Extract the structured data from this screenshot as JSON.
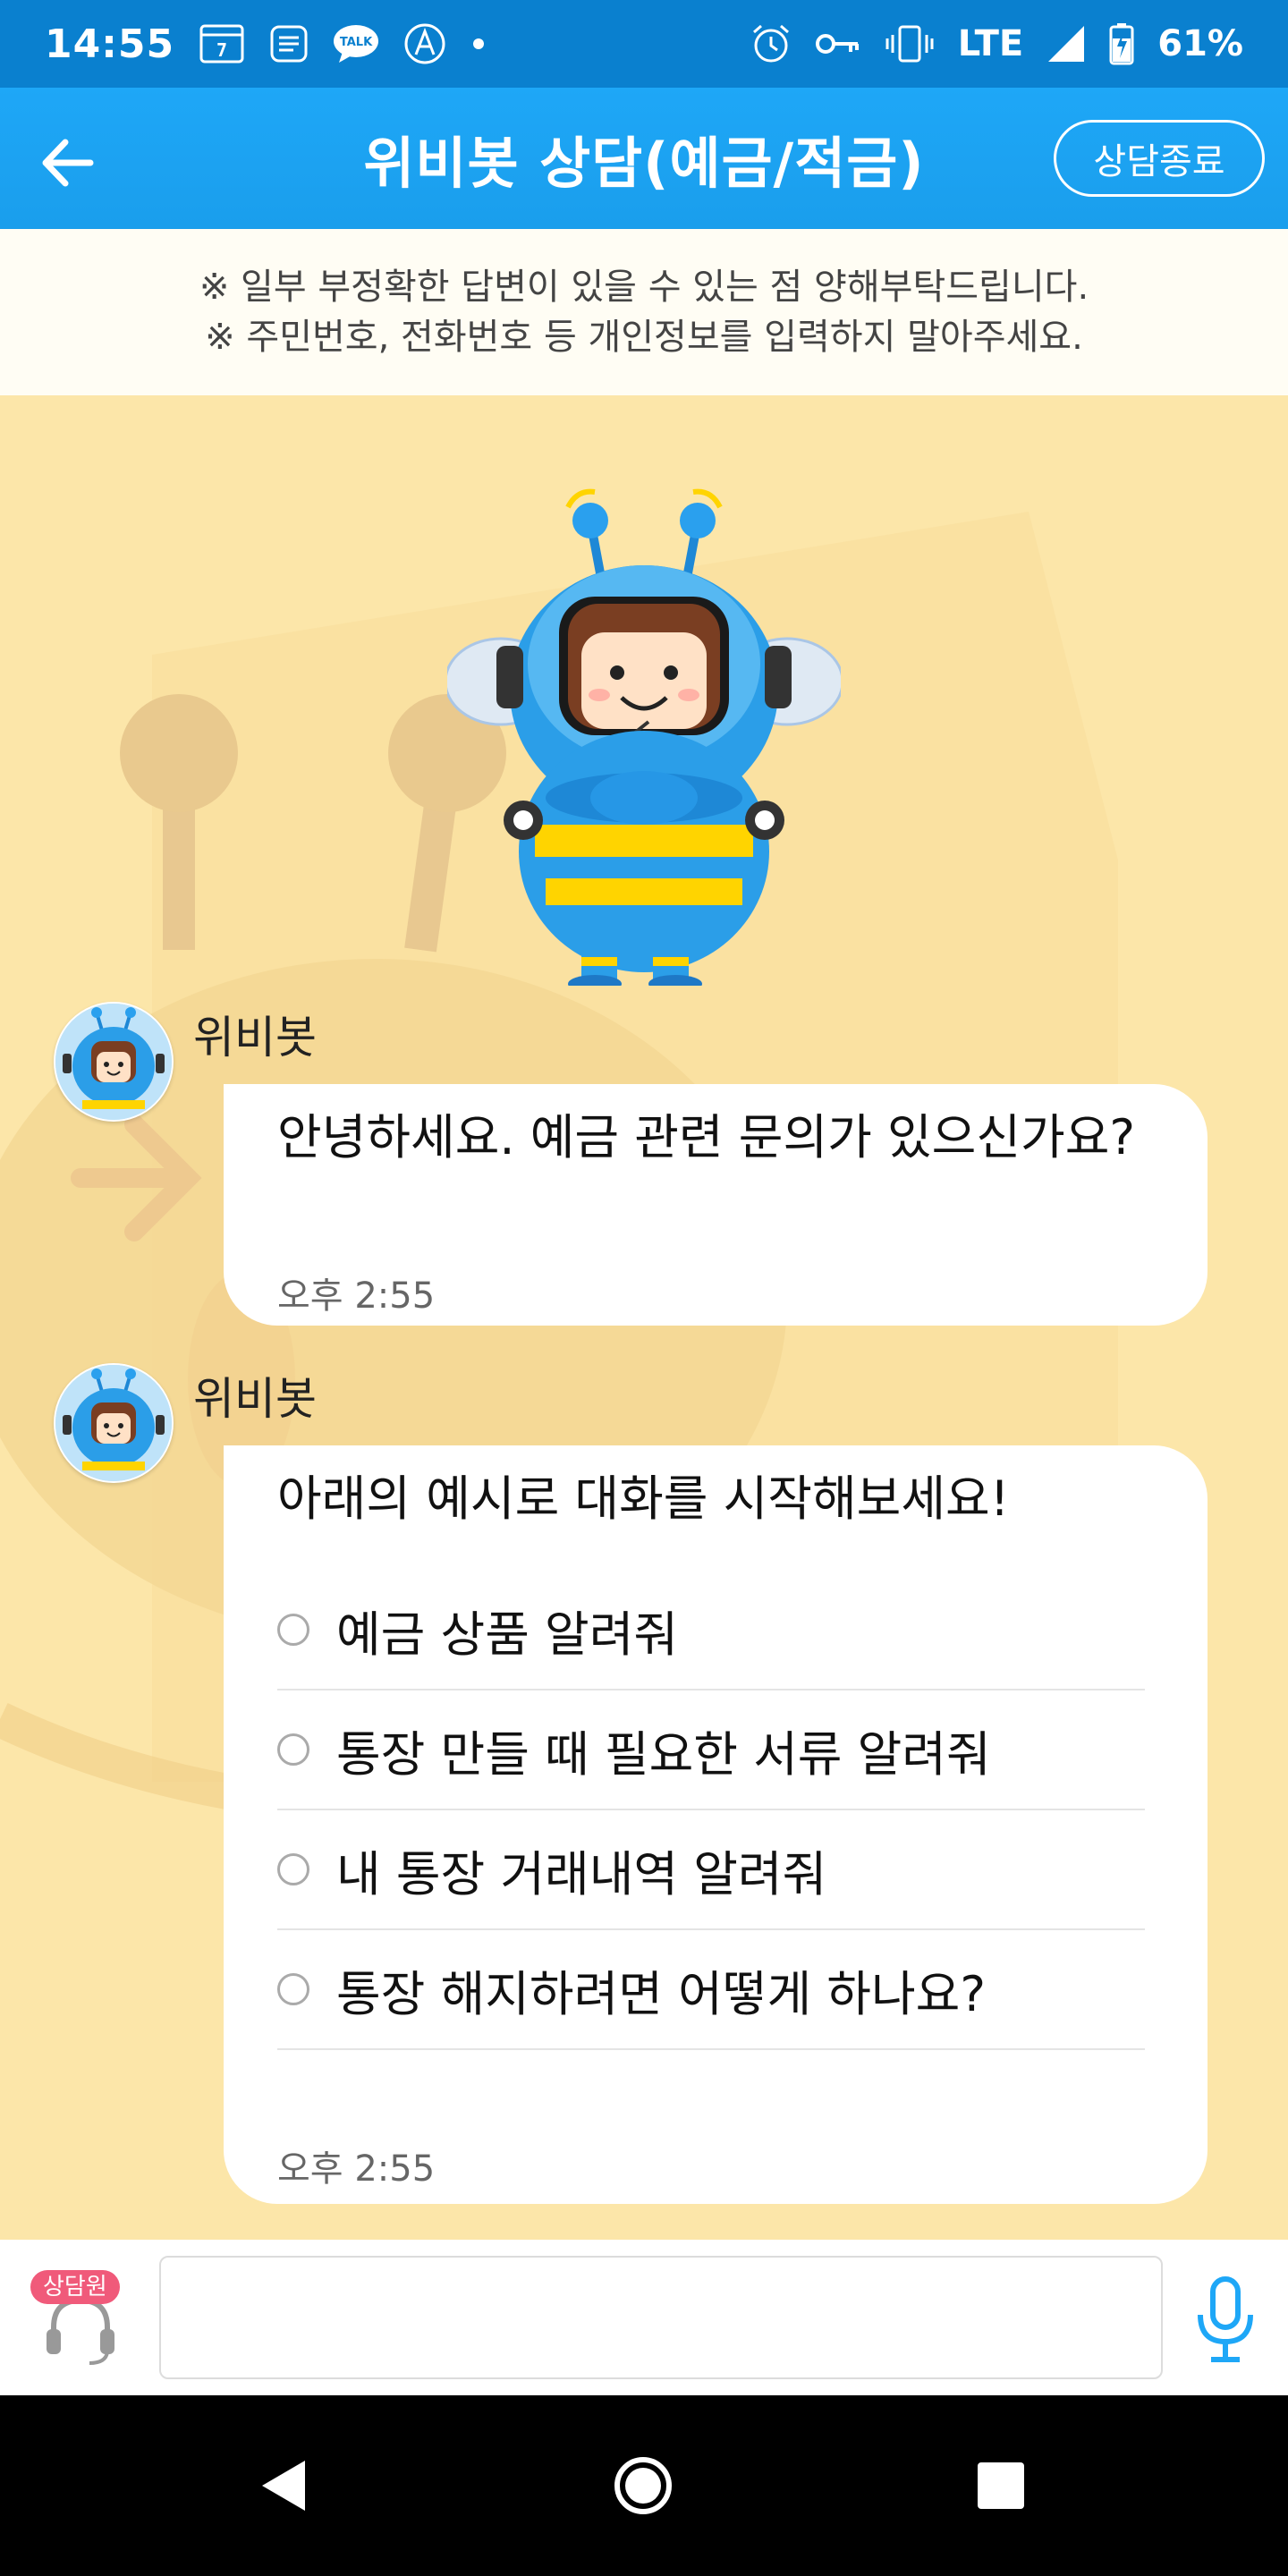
{
  "status_bar": {
    "time": "14:55",
    "network": "LTE",
    "battery": "61%",
    "icons": [
      "calendar-icon",
      "list-icon",
      "kakaotalk-icon",
      "app-icon",
      "dot-icon",
      "alarm-icon",
      "vpn-key-icon",
      "vibrate-icon",
      "signal-icon",
      "battery-icon"
    ],
    "talk_label": "TALK"
  },
  "app_bar": {
    "title": "위비봇 상담(예금/적금)",
    "end_button": "상담종료",
    "background": "#1ea7f7"
  },
  "notice": {
    "line1": "※ 일부 부정확한 답변이 있을 수 있는 점 양해부탁드립니다.",
    "line2": "※ 주민번호, 전화번호 등 개인정보를 입력하지 말아주세요."
  },
  "messages": [
    {
      "sender": "위비봇",
      "text": "안녕하세요. 예금 관련 문의가 있으신가요?",
      "time": "오후 2:55"
    },
    {
      "sender": "위비봇",
      "text": "아래의 예시로 대화를 시작해보세요!",
      "options": [
        "예금 상품 알려줘",
        "통장 만들 때 필요한 서류 알려줘",
        "내 통장 거래내역 알려줘",
        "통장 해지하려면 어떻게 하나요?"
      ],
      "time": "오후 2:55"
    }
  ],
  "input_bar": {
    "agent_badge": "상담원",
    "input_value": "",
    "input_placeholder": ""
  },
  "colors": {
    "accent": "#1ea7f7",
    "status_bar": "#0a80cf",
    "chat_background": "#fce6a9",
    "agent_badge": "#f05a7a",
    "mic": "#1ea7f7"
  }
}
